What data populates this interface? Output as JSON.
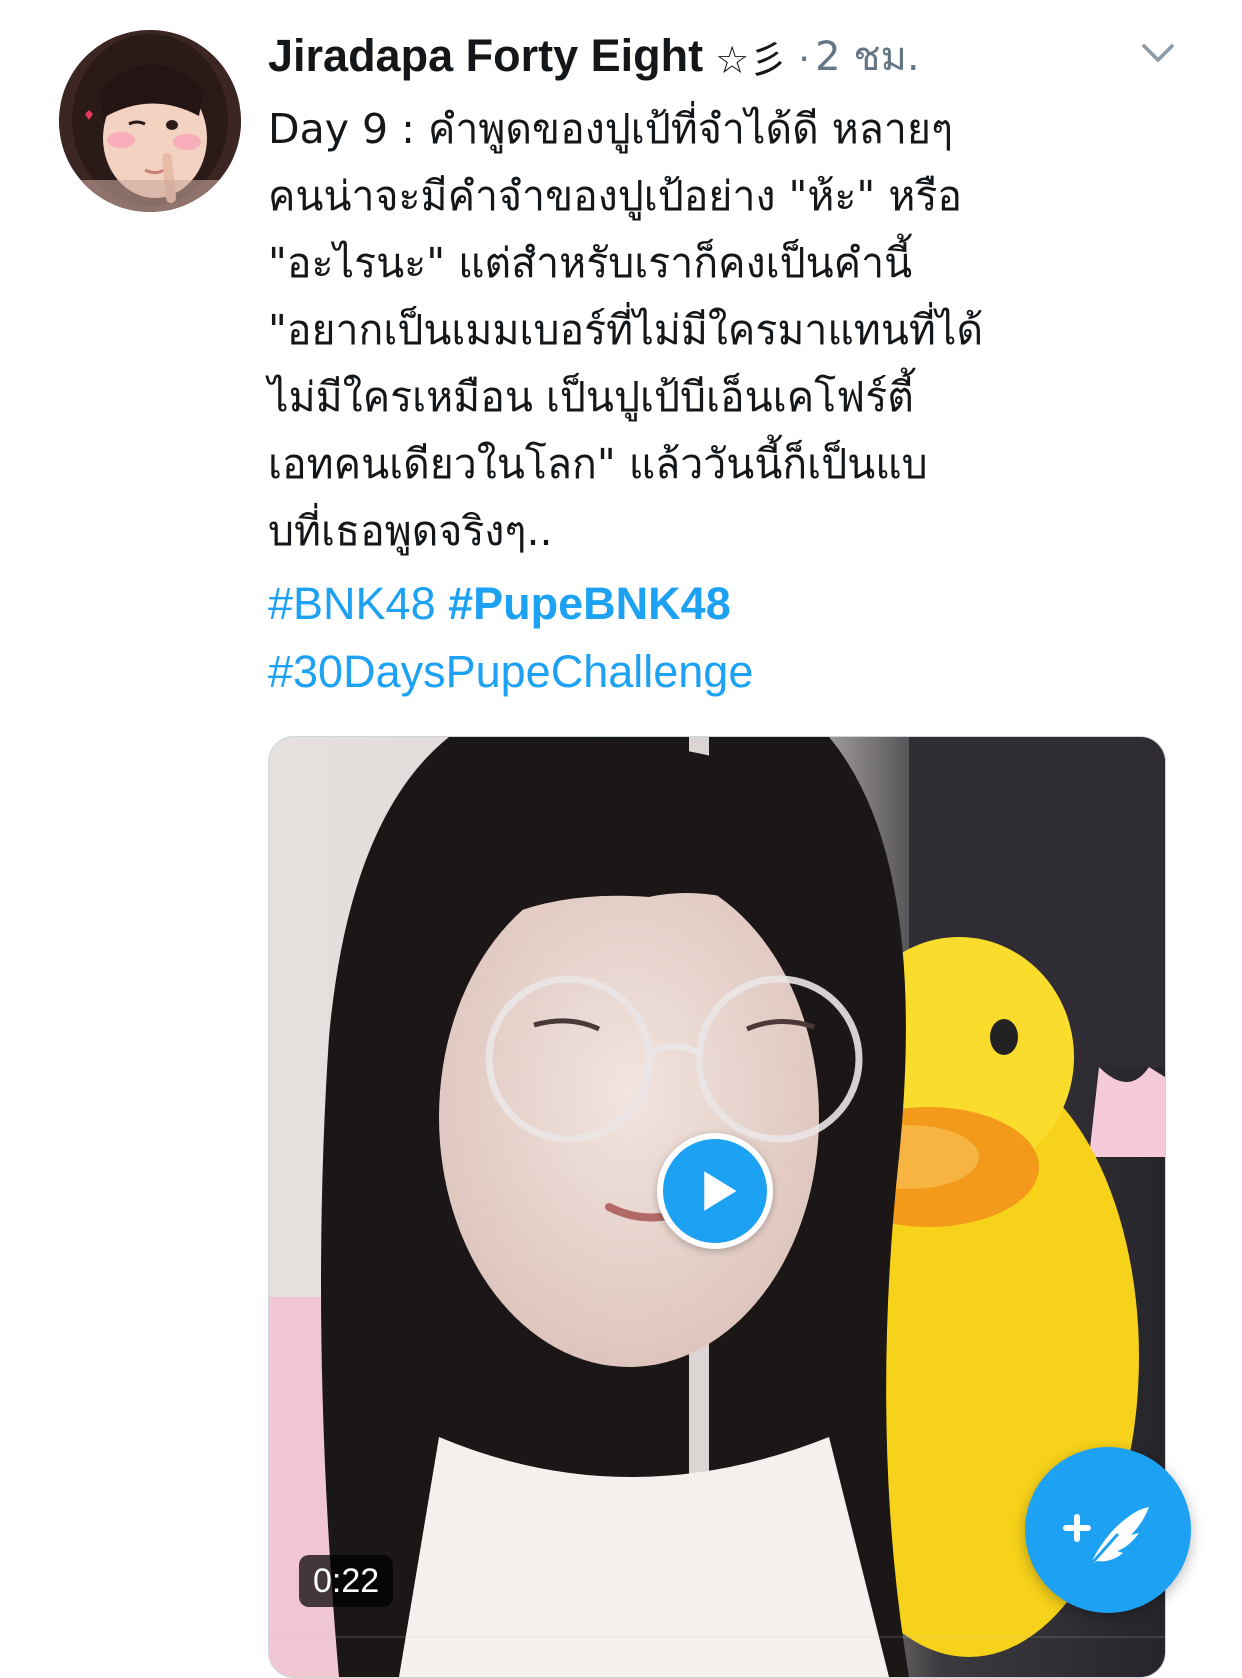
{
  "tweet": {
    "author": {
      "display_name": "Jiradapa Forty Eight",
      "name_decoration": "☆彡",
      "avatar_icon": "profile-photo"
    },
    "separator": "·",
    "timestamp": "2 ชม.",
    "more_icon": "chevron-down-icon",
    "text_lines": [
      "Day 9 : คำพูดของปูเป้ที่จำได้ดี หลายๆ",
      "คนน่าจะมีคำจำของปูเป้อย่าง \"ห้ะ\" หรือ",
      "\"อะไรนะ\" แต่สำหรับเราก็คงเป็นคำนี้",
      "\"อยากเป็นเมมเบอร์ที่ไม่มีใครมาแทนที่ได้",
      "ไม่มีใครเหมือน เป็นปูเป้บีเอ็นเคโฟร์ตี้",
      "เอทคนเดียวในโลก\" แล้ววันนี้ก็เป็นแบ",
      "บที่เธอพูดจริงๆ.."
    ],
    "hashtags": {
      "first": "#BNK48",
      "second": "#PupeBNK48",
      "third": "#30DaysPupeChallenge"
    },
    "media": {
      "type": "video",
      "duration": "0:22",
      "play_icon": "play-icon"
    }
  },
  "compose_button": {
    "icon": "compose-feather-icon"
  },
  "colors": {
    "accent": "#1da1f2",
    "text_primary": "#14171a",
    "text_secondary": "#657786"
  }
}
